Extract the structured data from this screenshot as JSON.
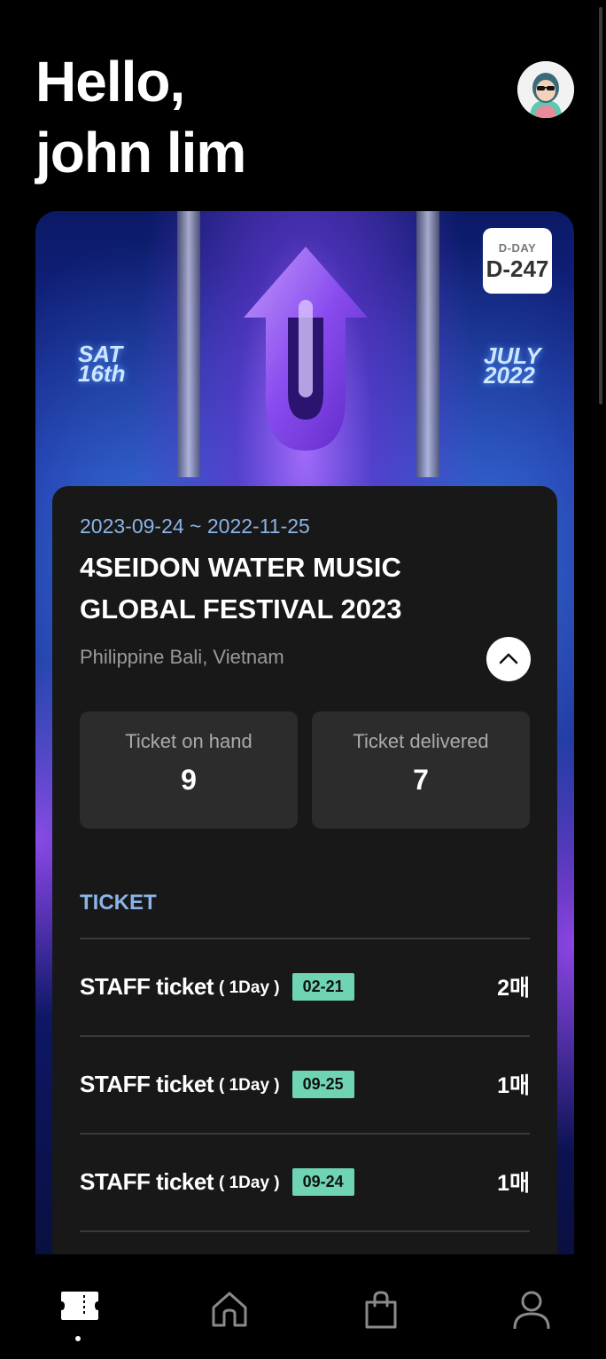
{
  "greeting": {
    "line1": "Hello,",
    "line2": "john lim"
  },
  "event": {
    "poster": {
      "date_left_1": "SAT",
      "date_left_2": "16th",
      "date_right_1": "JULY",
      "date_right_2": "2022"
    },
    "dday_label": "D-DAY",
    "dday_value": "D-247",
    "dates": "2023-09-24 ~ 2022-11-25",
    "title": "4SEIDON WATER MUSIC GLOBAL FESTIVAL 2023",
    "location": "Philippine Bali, Vietnam",
    "stats": [
      {
        "label": "Ticket on hand",
        "value": "9"
      },
      {
        "label": "Ticket delivered",
        "value": "7"
      }
    ]
  },
  "tickets": {
    "section_label": "TICKET",
    "items": [
      {
        "name": "STAFF ticket",
        "duration": "( 1Day )",
        "date": "02-21",
        "quantity": "2매"
      },
      {
        "name": "STAFF ticket",
        "duration": "( 1Day )",
        "date": "09-25",
        "quantity": "1매"
      },
      {
        "name": "STAFF ticket",
        "duration": "( 1Day )",
        "date": "09-24",
        "quantity": "1매"
      }
    ]
  },
  "tabbar": {
    "tabs": [
      {
        "icon": "ticket-icon",
        "active": true
      },
      {
        "icon": "home-icon",
        "active": false
      },
      {
        "icon": "shopping-bag-icon",
        "active": false
      },
      {
        "icon": "profile-icon",
        "active": false
      }
    ]
  },
  "colors": {
    "accent": "#8ab4e8",
    "badge": "#6fd4b4",
    "card": "#181818",
    "stat_bg": "#2c2c2c"
  }
}
